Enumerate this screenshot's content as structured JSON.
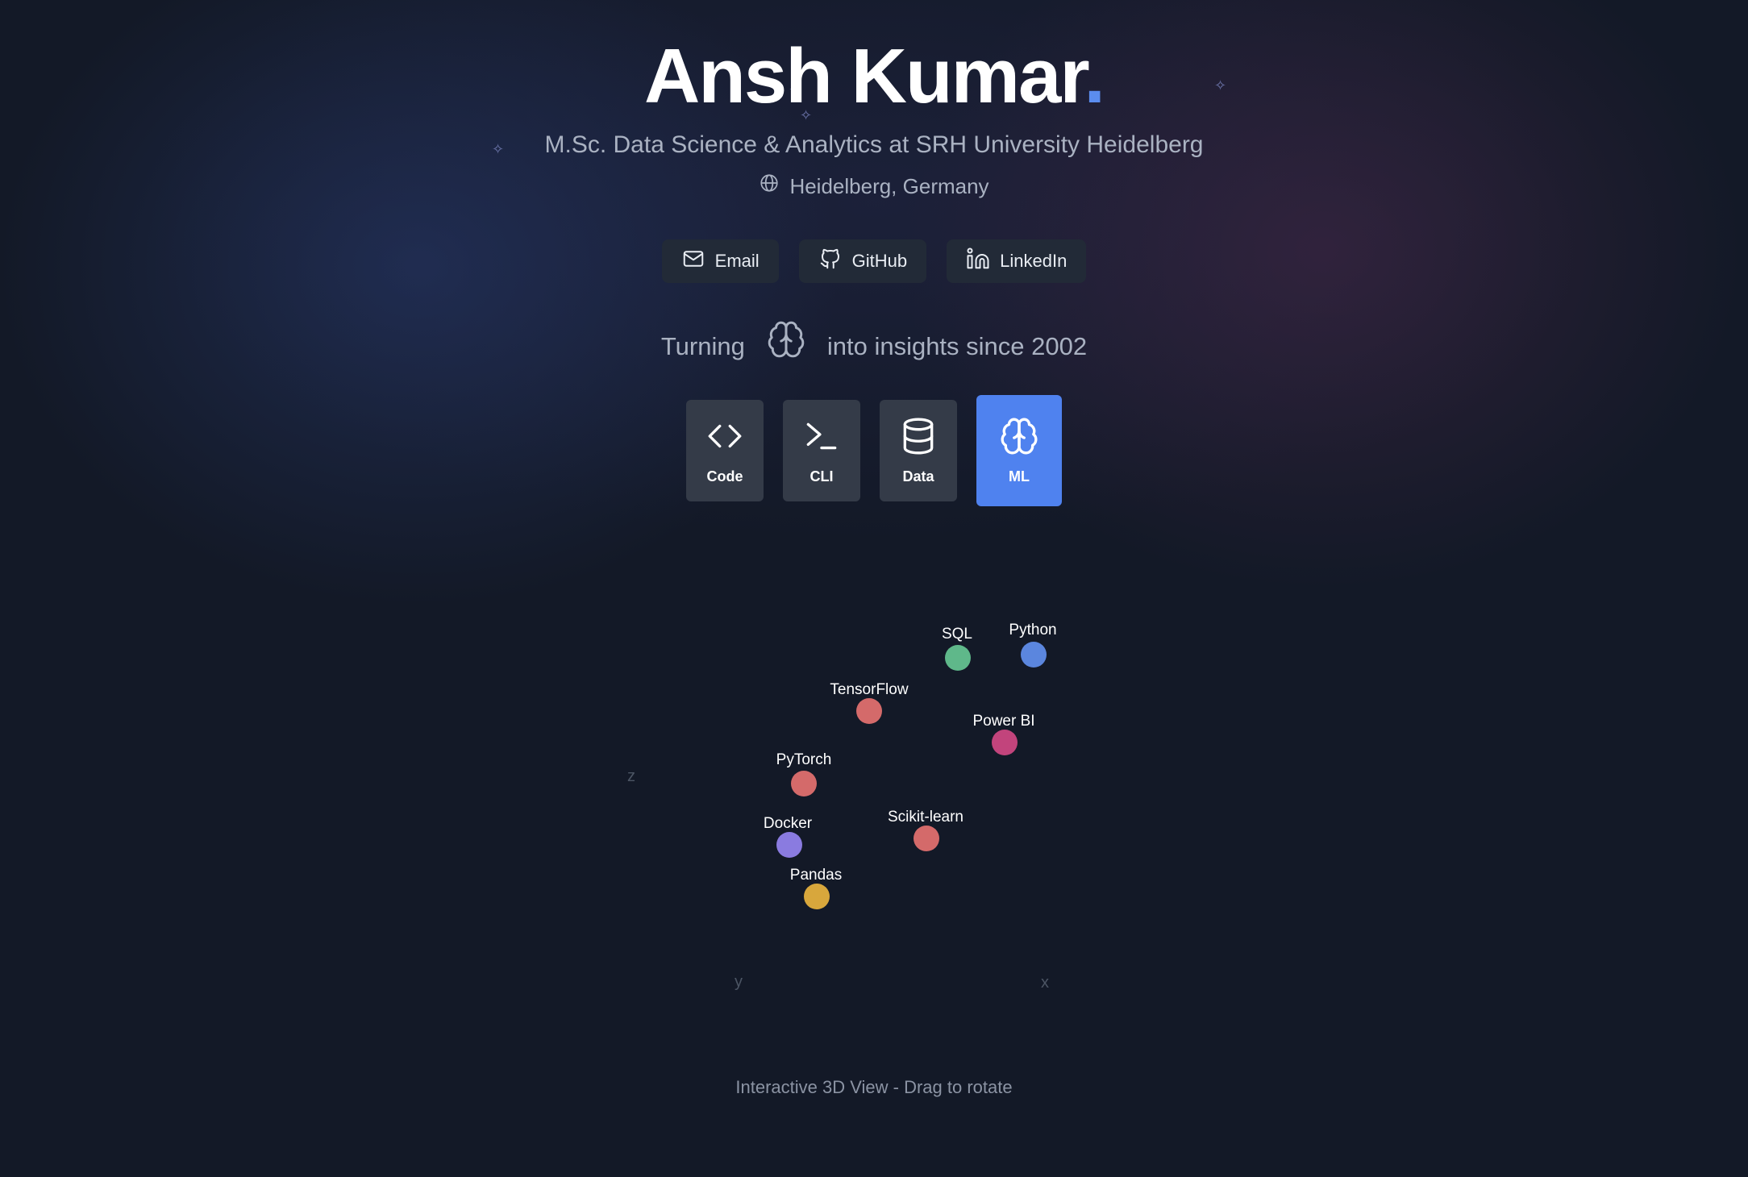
{
  "header": {
    "name": "Ansh Kumar",
    "name_dot": ".",
    "subtitle": "M.Sc. Data Science & Analytics at SRH University Heidelberg",
    "location": "Heidelberg, Germany",
    "accent_color": "#5b8def"
  },
  "links": [
    {
      "label": "Email",
      "icon": "mail-icon"
    },
    {
      "label": "GitHub",
      "icon": "github-icon"
    },
    {
      "label": "LinkedIn",
      "icon": "linkedin-icon"
    }
  ],
  "tagline": {
    "before": "Turning",
    "icon": "brain-icon",
    "after": "into insights since 2002"
  },
  "tools": [
    {
      "label": "Code",
      "icon": "code-icon",
      "active": false
    },
    {
      "label": "CLI",
      "icon": "terminal-icon",
      "active": false
    },
    {
      "label": "Data",
      "icon": "database-icon",
      "active": false
    },
    {
      "label": "ML",
      "icon": "brain-icon",
      "active": true
    }
  ],
  "skills_view": {
    "axes": [
      "x",
      "y",
      "z"
    ],
    "points": [
      {
        "label": "SQL",
        "color": "#5fb88a"
      },
      {
        "label": "Python",
        "color": "#5b86de"
      },
      {
        "label": "TensorFlow",
        "color": "#d46a6a"
      },
      {
        "label": "Power BI",
        "color": "#c2447c"
      },
      {
        "label": "PyTorch",
        "color": "#d46a6a"
      },
      {
        "label": "Docker",
        "color": "#8a7be0"
      },
      {
        "label": "Scikit-learn",
        "color": "#d46a6a"
      },
      {
        "label": "Pandas",
        "color": "#d8a73c"
      }
    ]
  },
  "footer": "Interactive 3D View - Drag to rotate"
}
